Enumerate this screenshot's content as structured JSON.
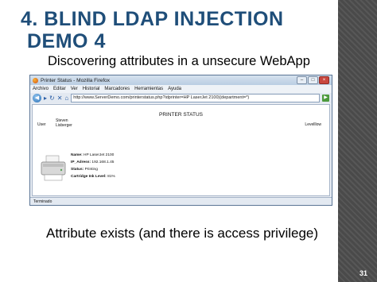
{
  "slide": {
    "title_line1": "4. BLIND LDAP INJECTION",
    "title_line2": "DEMO 4",
    "subtitle": "Discovering attributes in a unsecure WebApp",
    "caption": "Attribute exists (and there is access privilege)",
    "slide_number": "31"
  },
  "browser": {
    "window_title": "Printer Status - Mozilla Firefox",
    "menu": [
      "Archivo",
      "Editar",
      "Ver",
      "Historial",
      "Marcadores",
      "Herramientas",
      "Ayuda"
    ],
    "url": "http://www.ServerDemo.com/printerstatus.php?idprinter=HP LaserJet 2100)(department=*)",
    "status_text": "Terminado"
  },
  "page": {
    "heading": "PRINTER STATUS",
    "user_label": "User",
    "user_name_line1": "Steven",
    "user_name_line2": "Lisberger",
    "level_label": "Levelllow",
    "name_label": "Name:",
    "name_value": "HP LaserJet 2100",
    "ip_label": "IP_Adress:",
    "ip_value": "192.168.1.45",
    "status_label": "Status:",
    "status_value": "Printing",
    "cartridge_label": "Cartridge Ink Level:",
    "cartridge_value": "81%"
  },
  "colors": {
    "title": "#1f4e79",
    "right_bar": "#4a4a4a"
  }
}
